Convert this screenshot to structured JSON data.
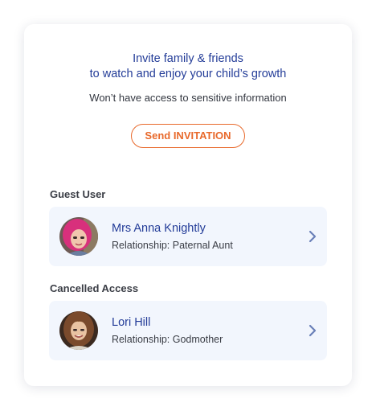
{
  "invite": {
    "title_line1": "Invite family & friends",
    "title_line2": "to watch and enjoy your child’s growth",
    "subtitle": "Won’t have access to sensitive information",
    "button_label": "Send INVITATION"
  },
  "colors": {
    "accent_orange": "#e8692b",
    "name_blue": "#233c98",
    "row_background": "#f2f6fd",
    "chevron": "#6a80b8"
  },
  "guest_section": {
    "label": "Guest User",
    "users": [
      {
        "name": "Mrs Anna Knightly",
        "relationship": "Relationship: Paternal Aunt",
        "avatar": "photo-woman-pink-hair"
      }
    ]
  },
  "cancelled_section": {
    "label": "Cancelled Access",
    "users": [
      {
        "name": "Lori Hill",
        "relationship": "Relationship: Godmother",
        "avatar": "photo-woman-brown-hair"
      }
    ]
  }
}
